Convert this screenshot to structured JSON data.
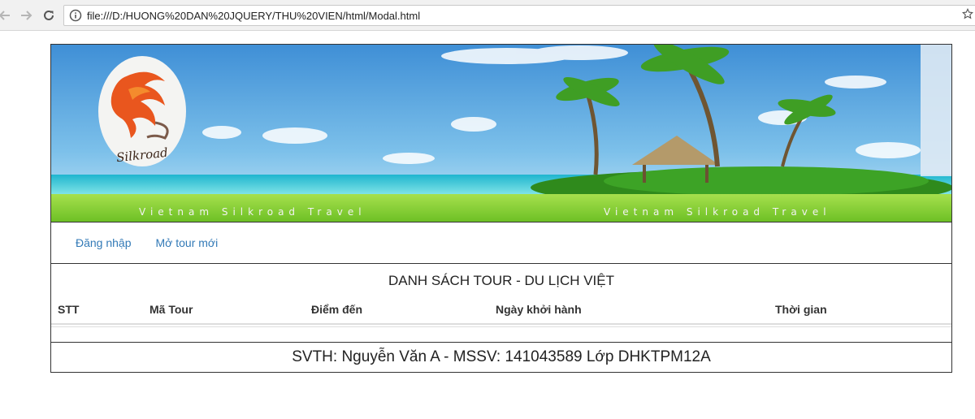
{
  "browser": {
    "url": "file:///D:/HUONG%20DAN%20JQUERY/THU%20VIEN/html/Modal.html"
  },
  "banner": {
    "logo_text": "Silkroad",
    "caption_left": "Vietnam Silkroad Travel",
    "caption_right": "Vietnam Silkroad Travel"
  },
  "menu": {
    "items": [
      {
        "label": "Đăng nhập"
      },
      {
        "label": "Mở tour mới"
      }
    ]
  },
  "tour_list": {
    "title": "DANH SÁCH TOUR - DU LỊCH VIỆT",
    "columns": [
      "STT",
      "Mã Tour",
      "Điểm đến",
      "Ngày khởi hành",
      "Thời gian"
    ]
  },
  "footer": {
    "text": "SVTH: Nguyễn Văn A - MSSV: 141043589 Lớp DHKTPM12A"
  },
  "colors": {
    "link": "#337ab7",
    "border": "#333333",
    "sea": "#3ec7d6",
    "grass": "#8fd23a"
  }
}
